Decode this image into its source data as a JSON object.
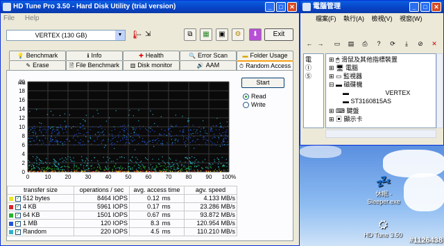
{
  "hdtune": {
    "title": "HD Tune Pro 3.50 - Hard Disk Utility (trial version)",
    "menu": [
      "File",
      "Help"
    ],
    "drive": "VERTEX (130 GB)",
    "temperature": "--",
    "exit_label": "Exit",
    "tabs_row1": [
      "Benchmark",
      "Info",
      "Health",
      "Error Scan",
      "Folder Usage"
    ],
    "tabs_row2": [
      "Erase",
      "File Benchmark",
      "Disk monitor",
      "AAM",
      "Random Access"
    ],
    "active_tab": "Random Access",
    "start_label": "Start",
    "read_label": "Read",
    "write_label": "Write",
    "headers": [
      "transfer size",
      "operations / sec",
      "avg. access time",
      "agv. speed"
    ],
    "rows": [
      {
        "color": "#e8e52a",
        "size": "512 bytes",
        "ops": "8464 IOPS",
        "time": "0.12",
        "tunit": "ms",
        "speed": "4.133 MB/s"
      },
      {
        "color": "#d6262a",
        "size": "4 KB",
        "ops": "5961 IOPS",
        "time": "0.17",
        "tunit": "ms",
        "speed": "23.286 MB/s"
      },
      {
        "color": "#25b42a",
        "size": "64 KB",
        "ops": "1501 IOPS",
        "time": "0.67",
        "tunit": "ms",
        "speed": "93.872 MB/s"
      },
      {
        "color": "#2352d8",
        "size": "1 MB",
        "ops": "120 IOPS",
        "time": "8.3",
        "tunit": "ms",
        "speed": "120.954 MB/s"
      },
      {
        "color": "#2bb3c9",
        "size": "Random",
        "ops": "220 IOPS",
        "time": "4.5",
        "tunit": "ms",
        "speed": "110.210 MB/s"
      }
    ]
  },
  "chart_data": {
    "type": "scatter",
    "ylabel": "ms",
    "ylim": [
      0,
      20
    ],
    "yticks": [
      "0",
      "2",
      "4",
      "6",
      "8",
      "10",
      "12",
      "14",
      "16",
      "18",
      "20"
    ],
    "xlim": [
      0,
      100
    ],
    "xticks": [
      "0",
      "10",
      "20",
      "30",
      "40",
      "50",
      "60",
      "70",
      "80",
      "90",
      "100%"
    ],
    "grid": true,
    "series": [
      {
        "name": "512 bytes",
        "color": "#e8e52a",
        "y_band": [
          0.05,
          0.3
        ]
      },
      {
        "name": "4 KB",
        "color": "#d6262a",
        "y_band": [
          0.1,
          0.4
        ]
      },
      {
        "name": "64 KB",
        "color": "#25b42a",
        "y_band": [
          0.4,
          1.5
        ]
      },
      {
        "name": "1 MB",
        "color": "#2352d8",
        "y_band": [
          6.0,
          10.5
        ]
      },
      {
        "name": "Random",
        "color": "#2bb3c9",
        "y_band": [
          0.5,
          14.0
        ]
      }
    ]
  },
  "devmgr": {
    "title": "電腦管理",
    "menu": [
      "檔案(F)",
      "執行(A)",
      "檢視(V)",
      "視窗(W)"
    ],
    "left_items": [
      "電",
      "Ⓘ",
      "Ⓢ"
    ],
    "tree": [
      "滑鼠及其他指標裝置",
      "電腦",
      "監視器",
      "磁碟機",
      "VERTEX",
      "ST3160815AS",
      "鍵盤",
      "顯示卡"
    ]
  },
  "desktop": {
    "icons": [
      "休眠 - Sleeper.exe",
      "HD Tune 3.50"
    ],
    "watermark": "#1126438"
  }
}
